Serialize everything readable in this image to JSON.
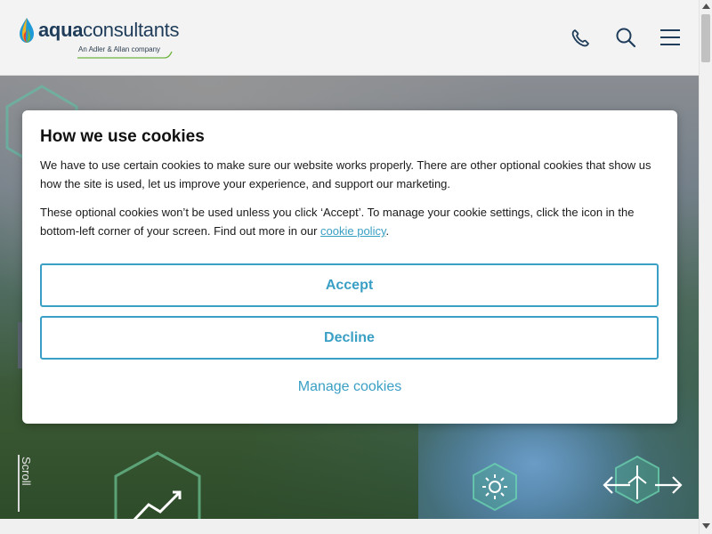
{
  "header": {
    "logo": {
      "brand_bold": "aqua",
      "brand_light": "consultants",
      "tagline": "An Adler & Allan company"
    },
    "icons": [
      "phone-icon",
      "search-icon",
      "menu-icon"
    ]
  },
  "hero": {
    "scroll_label": "Scroll"
  },
  "cookie_modal": {
    "title": "How we use cookies",
    "paragraph_1": "We have to use certain cookies to make sure our website works properly. There are other optional cookies that show us how the site is used, let us improve your experience, and support our marketing.",
    "paragraph_2_before": "These optional cookies won’t be used unless you click ‘Accept’. To manage your cookie settings, click the icon in the bottom-left corner of your screen. Find out more in our ",
    "paragraph_2_link": "cookie policy",
    "paragraph_2_after": ".",
    "accept_label": "Accept",
    "decline_label": "Decline",
    "manage_label": "Manage cookies"
  },
  "colors": {
    "accent": "#3a9fc4",
    "brand_navy": "#1f3d5a",
    "header_bg": "#f3f3f3"
  }
}
